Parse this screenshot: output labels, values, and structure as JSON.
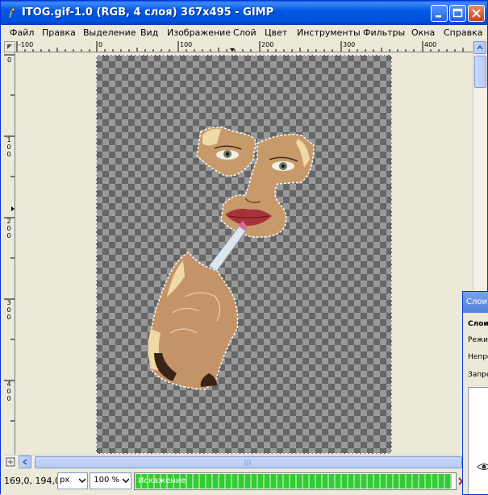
{
  "window": {
    "title": "ITOG.gif-1.0 (RGB, 4 слоя) 367x495 - GIMP",
    "icon": "gimp-wilber-icon",
    "controls": [
      "minimize-icon",
      "maximize-icon",
      "close-icon"
    ]
  },
  "menu": {
    "items": [
      {
        "label": "Файл"
      },
      {
        "label": "Правка"
      },
      {
        "label": "Выделение"
      },
      {
        "label": "Вид"
      },
      {
        "label": "Изображение"
      },
      {
        "label": "Слой"
      },
      {
        "label": "Цвет"
      },
      {
        "label": "Инструменты"
      },
      {
        "label": "Фильтры"
      },
      {
        "label": "Окна"
      },
      {
        "label": "Справка"
      }
    ]
  },
  "ruler": {
    "horizontal": [
      "-100",
      "0",
      "100",
      "200",
      "300",
      "400"
    ],
    "vertical": [
      "0",
      "100",
      "200",
      "300",
      "400"
    ]
  },
  "status": {
    "coords": "169,0, 194,0",
    "unit": "px",
    "zoom": "100 %",
    "progress_label": "Искажение",
    "progress_fraction": 0.99
  },
  "layers_dialog": {
    "title": "Слои",
    "tab": "Слои",
    "mode": "Режим",
    "opacity": "Непро",
    "lock": "Запре"
  },
  "colors": {
    "titlebar": "#0058e6",
    "progress": "#33cc33",
    "checker_dark": "#666666",
    "checker_light": "#999999"
  }
}
